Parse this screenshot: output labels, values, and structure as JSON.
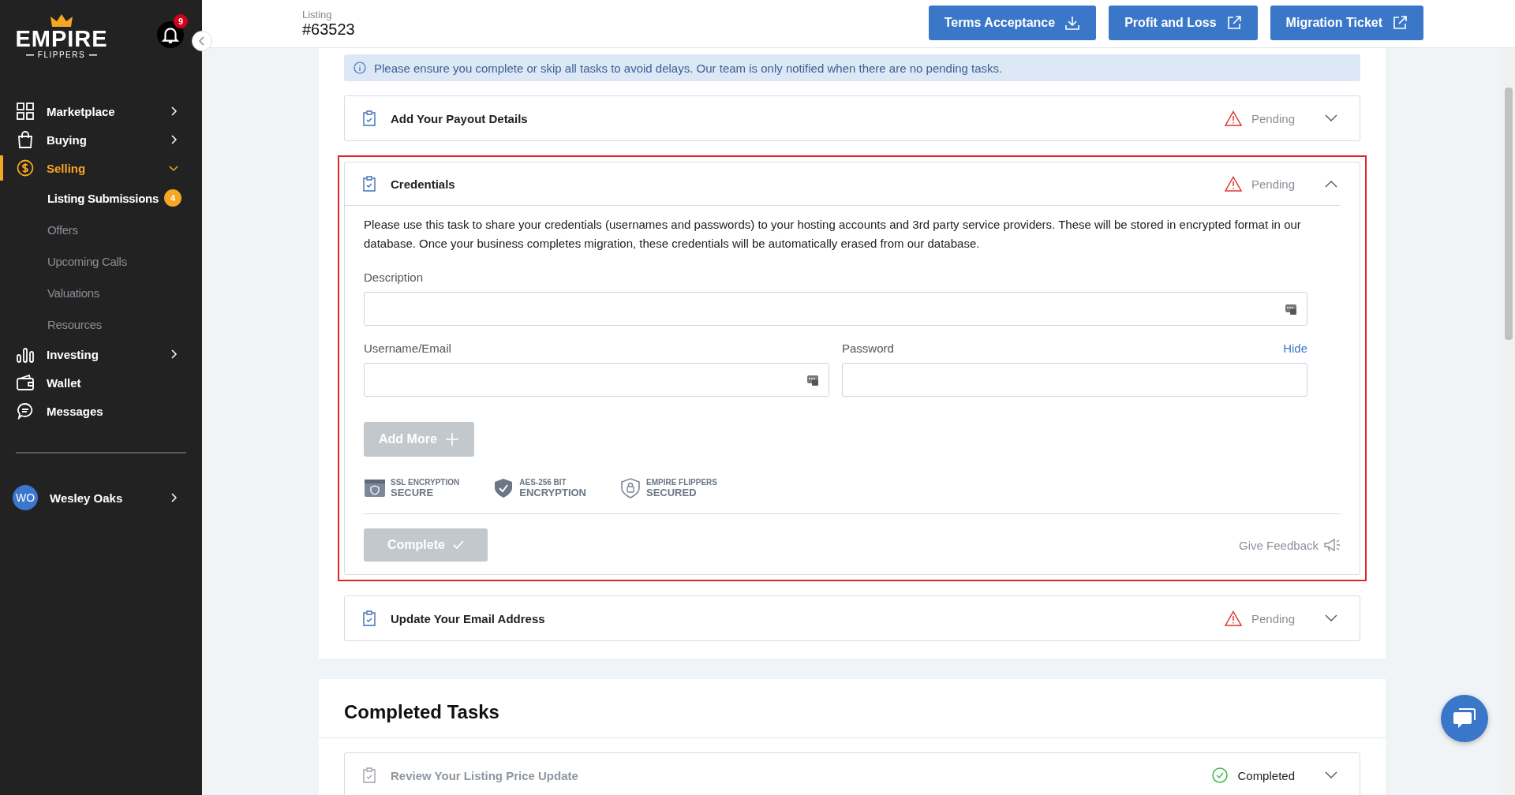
{
  "sidebar": {
    "logo": {
      "word": "EMPIRE",
      "sub": "FLIPPERS"
    },
    "notifications": {
      "count": "9"
    },
    "items": [
      {
        "label": "Marketplace",
        "selected": false,
        "expanded": false
      },
      {
        "label": "Buying",
        "selected": false,
        "expanded": false
      },
      {
        "label": "Selling",
        "selected": true,
        "expanded": true,
        "children": [
          {
            "label": "Listing Submissions",
            "selected": true,
            "badge": "4"
          },
          {
            "label": "Offers",
            "selected": false
          },
          {
            "label": "Upcoming Calls",
            "selected": false
          },
          {
            "label": "Valuations",
            "selected": false
          },
          {
            "label": "Resources",
            "selected": false
          }
        ]
      },
      {
        "label": "Investing",
        "selected": false,
        "expanded": false
      },
      {
        "label": "Wallet",
        "selected": false
      },
      {
        "label": "Messages",
        "selected": false
      }
    ],
    "user": {
      "initials": "WO",
      "name": "Wesley Oaks"
    }
  },
  "header": {
    "label": "Listing",
    "listing_number": "#63523",
    "buttons": [
      {
        "label": "Terms Acceptance",
        "kind": "download"
      },
      {
        "label": "Profit and Loss",
        "kind": "external"
      },
      {
        "label": "Migration Ticket",
        "kind": "external"
      }
    ]
  },
  "notice": "Please ensure you complete or skip all tasks to avoid delays. Our team is only notified when there are no pending tasks.",
  "tasks": [
    {
      "title": "Add Your Payout Details",
      "status": "Pending",
      "completed": false,
      "expanded": false,
      "highlighted": false
    },
    {
      "title": "Credentials",
      "status": "Pending",
      "completed": false,
      "expanded": true,
      "highlighted": true
    },
    {
      "title": "Update Your Email Address",
      "status": "Pending",
      "completed": false,
      "expanded": false,
      "highlighted": false
    }
  ],
  "credentials_form": {
    "intro": "Please use this task to share your credentials (usernames and passwords) to your hosting accounts and 3rd party service providers. These will be stored in encrypted format in our database. Once your business completes migration, these credentials will be automatically erased from our database.",
    "description_label": "Description",
    "username_label": "Username/Email",
    "password_label": "Password",
    "password_toggle": "Hide",
    "add_more": {
      "label": "Add More",
      "disabled": true
    },
    "badges": [
      {
        "top": "SSL ENCRYPTION",
        "bottom": "SECURE"
      },
      {
        "top": "AES-256 BIT",
        "bottom": "ENCRYPTION"
      },
      {
        "top": "EMPIRE FLIPPERS",
        "bottom": "SECURED"
      }
    ],
    "complete": {
      "label": "Complete",
      "disabled": true
    },
    "feedback": "Give Feedback"
  },
  "completed_section": {
    "title": "Completed Tasks",
    "tasks": [
      {
        "title": "Review Your Listing Price Update",
        "status": "Completed",
        "completed": true,
        "expanded": false
      }
    ]
  }
}
